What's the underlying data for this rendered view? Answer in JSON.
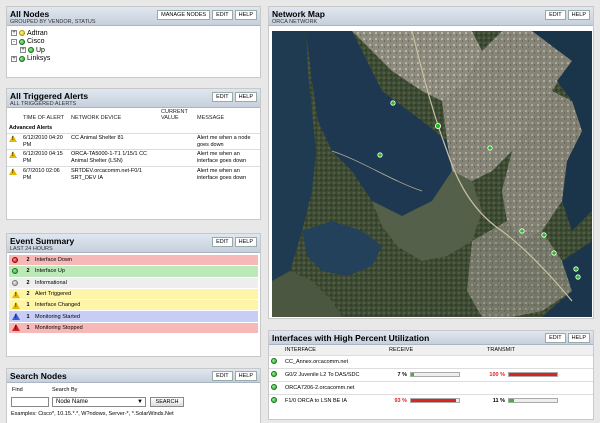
{
  "buttons": {
    "manage_nodes": "MANAGE NODES",
    "edit": "EDIT",
    "help": "HELP"
  },
  "all_nodes": {
    "title": "All Nodes",
    "subtitle": "GROUPED BY VENDOR, STATUS",
    "tree": [
      {
        "label": "Adtran",
        "status": "yellow",
        "expander": "+",
        "level": 0
      },
      {
        "label": "Cisco",
        "status": "green",
        "expander": "-",
        "level": 0
      },
      {
        "label": "Up",
        "status": "green",
        "expander": "+",
        "level": 1
      },
      {
        "label": "Linksys",
        "status": "green",
        "expander": "+",
        "level": 0
      }
    ]
  },
  "alerts": {
    "title": "All Triggered Alerts",
    "subtitle": "ALL TRIGGERED ALERTS",
    "columns": [
      "TIME OF ALERT",
      "NETWORK DEVICE",
      "CURRENT VALUE",
      "MESSAGE"
    ],
    "group": "Advanced Alerts",
    "rows": [
      {
        "time": "6/12/2010 04:20 PM",
        "device": "CC Animal Shelter 81",
        "value": "",
        "message": "Alert me when a node goes down"
      },
      {
        "time": "6/12/2010 04:15 PM",
        "device": "ORCA-TA5000-1-T1 1/15/1 CC Animal Shelter (LSN)",
        "value": "",
        "message": "Alert me when an interface goes down"
      },
      {
        "time": "6/7/2010 02:06 PM",
        "device": "SRTDEV.orcacomm.net-F0/1 SRT_DEV IA",
        "value": "",
        "message": "Alert me when an interface goes down"
      }
    ]
  },
  "events": {
    "title": "Event Summary",
    "subtitle": "LAST 24 HOURS",
    "rows": [
      {
        "count": "2",
        "label": "Interface Down",
        "bg": "#f7b8b8",
        "icon": "red-dot"
      },
      {
        "count": "2",
        "label": "Interface Up",
        "bg": "#bde9b8",
        "icon": "green-dot"
      },
      {
        "count": "2",
        "label": "Informational",
        "bg": "#eeeeee",
        "icon": "info-dot"
      },
      {
        "count": "2",
        "label": "Alert Triggered",
        "bg": "#fff5a8",
        "icon": "warning-triangle"
      },
      {
        "count": "1",
        "label": "Interface Changed",
        "bg": "#fff5a8",
        "icon": "warning-triangle"
      },
      {
        "count": "1",
        "label": "Monitoring Started",
        "bg": "#c7cdf5",
        "icon": "blue-triangle"
      },
      {
        "count": "1",
        "label": "Monitoring Stopped",
        "bg": "#f7b8b8",
        "icon": "red-triangle"
      }
    ]
  },
  "search": {
    "title": "Search Nodes",
    "find_label": "Find",
    "search_by_label": "Search By",
    "search_by_value": "Node Name",
    "search_button": "SEARCH",
    "examples": "Examples: Cisco*, 10.15.*.*, W?ndows, Server-*, *.SolarWinds.Net"
  },
  "map": {
    "title": "Network Map",
    "subtitle": "ORCA NETWORK"
  },
  "util": {
    "title": "Interfaces with High Percent Utilization",
    "columns": [
      "INTERFACE",
      "RECEIVE",
      "TRANSMIT"
    ],
    "rows": [
      {
        "interface": "CC_Annex.orcacomm.net",
        "receive": "",
        "transmit": "",
        "recv_frac": null,
        "tx_frac": null
      },
      {
        "interface": "G0/2 Juvenile L2 To DAS/SDC",
        "receive": "7 %",
        "transmit": "100 %",
        "recv_frac": 0.07,
        "tx_frac": 1.0
      },
      {
        "interface": "ORCA7206-2.orcacomm.net",
        "receive": "",
        "transmit": "",
        "recv_frac": null,
        "tx_frac": null
      },
      {
        "interface": "F1/0 ORCA to LSN BE IA",
        "receive": "93 %",
        "transmit": "11 %",
        "recv_frac": 0.93,
        "tx_frac": 0.11
      }
    ]
  },
  "colors": {
    "high_util": "#dd2222",
    "low_util": "#33bb33",
    "status_up": "#22a022"
  }
}
